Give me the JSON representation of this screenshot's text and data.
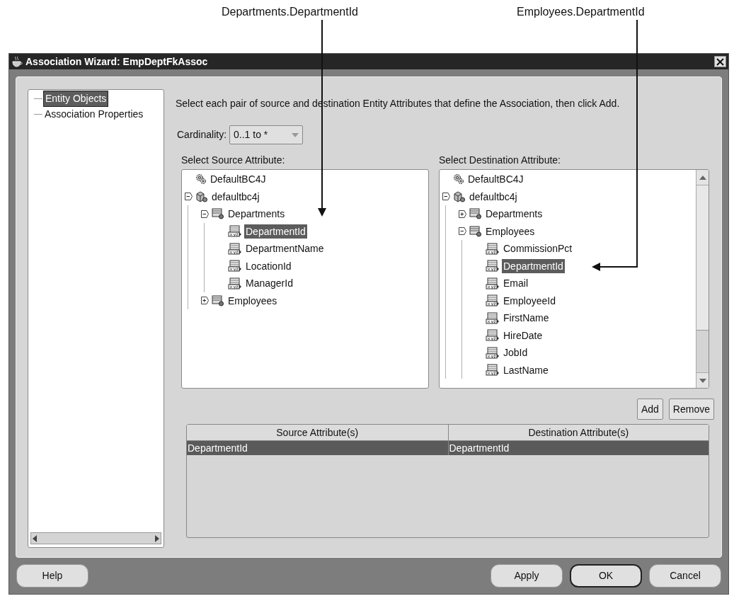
{
  "annotations": [
    {
      "label": "Departments.DepartmentId"
    },
    {
      "label": "Employees.DepartmentId"
    }
  ],
  "window": {
    "title": "Association Wizard: EmpDeptFkAssoc"
  },
  "steps": [
    {
      "label": "Entity Objects",
      "selected": true
    },
    {
      "label": "Association Properties",
      "selected": false
    }
  ],
  "instruction": "Select each pair of source and destination Entity Attributes that define the Association, then click Add.",
  "cardinality": {
    "label": "Cardinality:",
    "value": "0..1 to *"
  },
  "source_tree": {
    "label": "Select Source Attribute:",
    "items": [
      {
        "label": "DefaultBC4J",
        "kind": "project",
        "selected": false
      },
      {
        "label": "defaultbc4j",
        "kind": "package",
        "selected": false,
        "expanded": true,
        "children": [
          {
            "label": "Departments",
            "kind": "entity",
            "selected": false,
            "expanded": true,
            "children": [
              {
                "label": "DepartmentId",
                "kind": "attribute",
                "selected": true
              },
              {
                "label": "DepartmentName",
                "kind": "attribute",
                "selected": false
              },
              {
                "label": "LocationId",
                "kind": "attribute",
                "selected": false
              },
              {
                "label": "ManagerId",
                "kind": "attribute",
                "selected": false
              }
            ]
          },
          {
            "label": "Employees",
            "kind": "entity",
            "selected": false,
            "expanded": false
          }
        ]
      }
    ]
  },
  "destination_tree": {
    "label": "Select Destination Attribute:",
    "items": [
      {
        "label": "DefaultBC4J",
        "kind": "project",
        "selected": false
      },
      {
        "label": "defaultbc4j",
        "kind": "package",
        "selected": false,
        "expanded": true,
        "children": [
          {
            "label": "Departments",
            "kind": "entity",
            "selected": false,
            "expanded": false
          },
          {
            "label": "Employees",
            "kind": "entity",
            "selected": false,
            "expanded": true,
            "children": [
              {
                "label": "CommissionPct",
                "kind": "attribute",
                "selected": false
              },
              {
                "label": "DepartmentId",
                "kind": "attribute",
                "selected": true
              },
              {
                "label": "Email",
                "kind": "attribute",
                "selected": false
              },
              {
                "label": "EmployeeId",
                "kind": "attribute",
                "selected": false
              },
              {
                "label": "FirstName",
                "kind": "attribute",
                "selected": false
              },
              {
                "label": "HireDate",
                "kind": "attribute",
                "selected": false
              },
              {
                "label": "JobId",
                "kind": "attribute",
                "selected": false
              },
              {
                "label": "LastName",
                "kind": "attribute",
                "selected": false
              }
            ]
          }
        ]
      }
    ]
  },
  "pair_buttons": [
    "Add",
    "Remove"
  ],
  "table": {
    "columns": [
      "Source Attribute(s)",
      "Destination Attribute(s)"
    ],
    "rows": [
      {
        "cells": [
          "DepartmentId",
          "DepartmentId"
        ],
        "selected": true
      }
    ]
  },
  "footer_buttons": [
    {
      "label": "Help",
      "default": false
    },
    {
      "label": "Apply",
      "default": false
    },
    {
      "label": "OK",
      "default": true
    },
    {
      "label": "Cancel",
      "default": false
    }
  ]
}
